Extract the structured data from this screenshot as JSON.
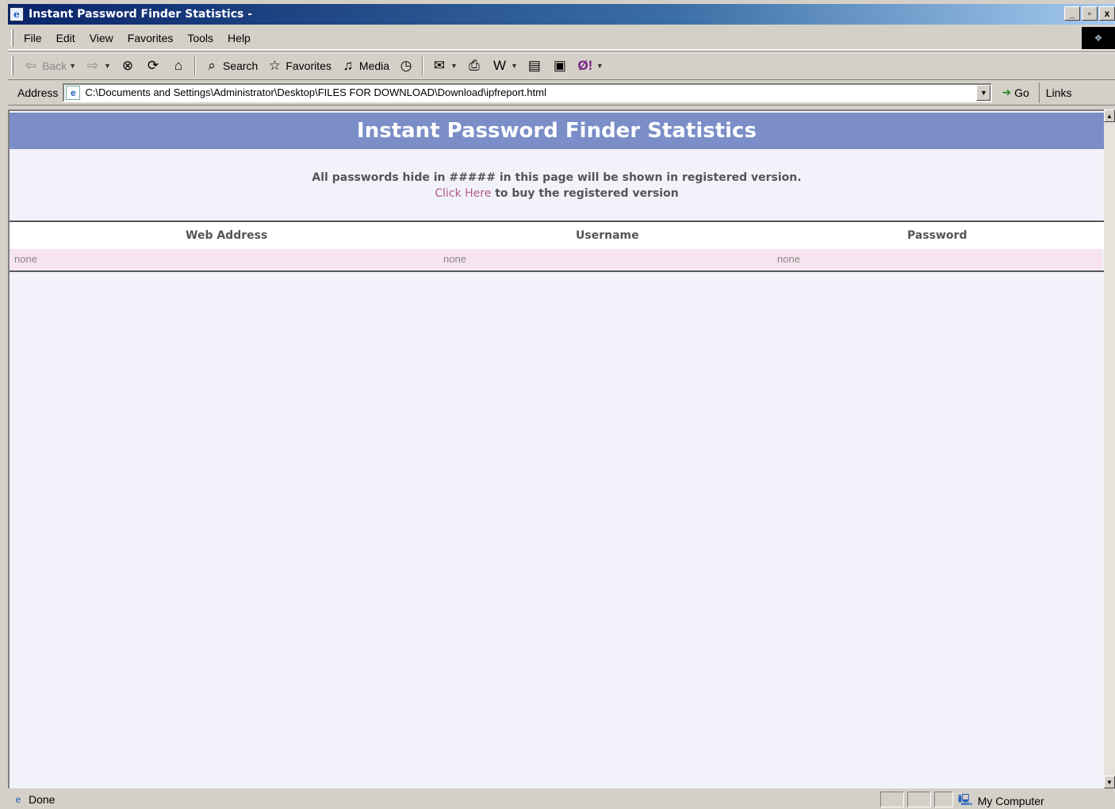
{
  "window": {
    "title": "Instant Password Finder Statistics -",
    "controls": [
      "_",
      "̶6",
      "x"
    ]
  },
  "menu": [
    "File",
    "Edit",
    "View",
    "Favorites",
    "Tools",
    "Help"
  ],
  "toolbar": {
    "back_label": "Back",
    "search_label": "Search",
    "favorites_label": "Favorites",
    "media_label": "Media"
  },
  "address": {
    "label": "Address",
    "url": "C:\\Documents and Settings\\Administrator\\Desktop\\FILES FOR DOWNLOAD\\Download\\ipfreport.html",
    "go_label": "Go",
    "links_label": "Links"
  },
  "page": {
    "heading": "Instant Password Finder Statistics",
    "notice_line1": "All passwords hide in ##### in this page will be shown in registered version.",
    "notice_link": "Click Here",
    "notice_line2_rest": " to buy the registered version",
    "columns": [
      "Web Address",
      "Username",
      "Password"
    ],
    "rows": [
      [
        "none",
        "none",
        "none"
      ]
    ]
  },
  "status": {
    "text": "Done",
    "zone": "My Computer"
  },
  "colors": {
    "banner": "#7b8ec8",
    "row_bg": "#f7e4ee",
    "link": "#b05a8a"
  }
}
